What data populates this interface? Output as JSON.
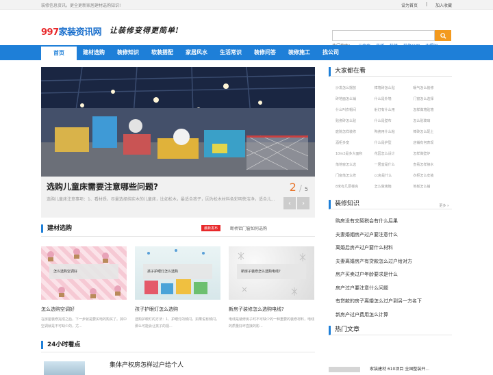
{
  "topbar": {
    "welcome": "装修信息资讯，更全更新家居建材选购知识!",
    "set_home": "设为首页",
    "separator": "|",
    "bookmark": "加入收藏"
  },
  "header": {
    "logo_num": "997",
    "logo_text": "家装资讯网",
    "slogan": "让装修变得更简单!",
    "search_placeholder": "",
    "hot_label": "热门搜索：",
    "hot_words": [
      "儿童房",
      "花桥",
      "装修",
      "装修公司",
      "衣帽间"
    ]
  },
  "nav": [
    "首页",
    "建材选购",
    "装修知识",
    "软装搭配",
    "家居风水",
    "生活常识",
    "装修问答",
    "装修施工",
    "找公司"
  ],
  "slider": {
    "title": "选购儿童床需要注意哪些问题?",
    "desc": "选购儿童床注意事项：1、看材质，尽量选择纯实木的儿童床，比如松木，最适合孩子，因为松木材料色彩明快洁净，适合儿...",
    "current": "2",
    "slash": "/",
    "total": "5",
    "prev": "‹",
    "next": "›"
  },
  "section1": {
    "title": "建材选购",
    "badge": "最新发布",
    "ticker": "断桥铝门窗如何选购",
    "cards": [
      {
        "label": "怎么选购空调好",
        "title": "怎么选购空调好",
        "desc": "在房屋装修完成之后，下一步就是要买电的购买了。其中空调就是不可缺少的，尤..."
      },
      {
        "label": "孩子护眼灯怎么选购",
        "title": "孩子护眼灯怎么选购",
        "desc": "选购护眼灯的方法：1、护眼灯的频闪，如果说有频闪，那么可能会让孩子的视..."
      },
      {
        "label": "新房子装修怎么选购电线?",
        "title": "新房子装修怎么选购电线?",
        "desc": "电线是装修房子时不可缺少的一种重要的装修材料，电线的质量好坏直接的影..."
      }
    ]
  },
  "section2": {
    "title": "24小时看点",
    "article": "集体产权房怎样过户给个人"
  },
  "sidebar": {
    "hot_title": "大家都在看",
    "tags": [
      "沙发怎么摆放",
      "樟墙砖怎么贴",
      "暖气怎么装修",
      "砖地面怎么铺",
      "什么是外墙",
      "门窗怎么选择",
      "什么叫衣帽间",
      "射灯有什么用",
      "怎样做墙贴墙",
      "贴瓷砖怎么贴",
      "什么是壁布",
      "怎么贴玻璃",
      "庭院怎样装修",
      "陶瓷用什么粘",
      "樟砖怎么配土",
      "酒柜多宽",
      "什么是护型",
      "店铺有何表现",
      "10m2是多大面积",
      "花园怎么设计",
      "怎样做壁炉",
      "落地窗怎么选",
      "一居室是什么",
      "查看怎样接水",
      "门窗落怎么修",
      "cc房是什么",
      "衣柜怎么安装",
      "8米有几层楼高",
      "怎么做烤箱",
      "地板怎么铺"
    ],
    "knowledge_title": "装修知识",
    "more": "更多 »",
    "knowledge_list": [
      "购房没有交契税会有什么后果",
      "夫妻婚姻房产过户要注意什么",
      "离婚后房产过户要什么材料",
      "夫妻离婚房产有贷款怎么过户给对方",
      "房产买卖过户年龄要求是什么",
      "房产过户要注意什么问题",
      "有贷款的房子离婚怎么过户到另一方名下",
      "新房产过户费用怎么计算"
    ],
    "popular_title": "热门文章",
    "popular_item": "家装建材 610项目 全国整装开..."
  },
  "colors": {
    "accent": "#1e7fd8",
    "logo_red": "#e8282a",
    "search_button": "#f39a1f",
    "pager": "#e8742a"
  }
}
